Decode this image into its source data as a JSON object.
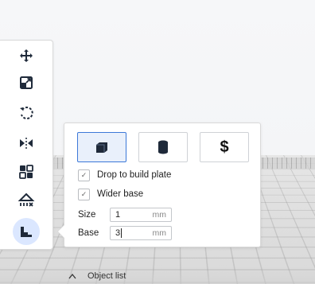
{
  "toolbar": {
    "tools": [
      {
        "name": "move",
        "icon": "move-icon"
      },
      {
        "name": "scale",
        "icon": "scale-icon"
      },
      {
        "name": "rotate",
        "icon": "rotate-icon"
      },
      {
        "name": "mirror",
        "icon": "mirror-icon"
      },
      {
        "name": "per-model-settings",
        "icon": "per-model-settings-icon"
      },
      {
        "name": "support-blocker",
        "icon": "support-blocker-icon"
      },
      {
        "name": "base-settings",
        "icon": "base-icon",
        "active": true
      }
    ]
  },
  "panel": {
    "type_buttons": [
      {
        "icon": "cube-icon",
        "selected": true
      },
      {
        "icon": "cylinder-icon",
        "selected": false
      },
      {
        "icon": "dollar-icon",
        "label": "$",
        "selected": false
      }
    ],
    "drop_to_build_plate": {
      "label": "Drop to build plate",
      "checked": true
    },
    "wider_base": {
      "label": "Wider base",
      "checked": true
    },
    "size": {
      "label": "Size",
      "value": "1",
      "unit": "mm"
    },
    "base": {
      "label": "Base",
      "value": "3",
      "unit": "mm"
    }
  },
  "object_list": {
    "label": "Object list"
  },
  "colors": {
    "accent": "#3c78d8",
    "active_bg": "#dbe7ff",
    "icon": "#1f2a3a"
  }
}
